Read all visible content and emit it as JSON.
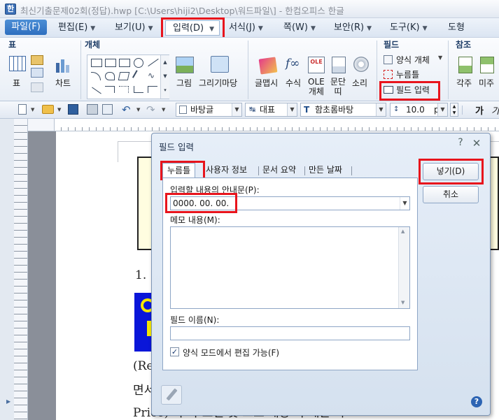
{
  "window": {
    "title": "최신기출문제02회(정답).hwp [C:\\Users\\hiji2\\Desktop\\워드파일\\] - 한컴오피스 한글"
  },
  "menu": {
    "file": "파일(F)",
    "items": [
      "편집(E)",
      "보기(U)",
      "입력(D)",
      "서식(J)",
      "쪽(W)",
      "보안(R)",
      "도구(K)",
      "도형"
    ]
  },
  "ribbon": {
    "groups": {
      "table": "표",
      "object": "개체",
      "field": "필드",
      "ref": "참조"
    },
    "table_label": "표",
    "chart_label": "차트",
    "picture_label": "그림",
    "drawing_label": "그리기마당",
    "textart_label": "글맵시",
    "formula_label": "수식",
    "ole_label": "OLE\n개체",
    "para_label": "문단\n띠",
    "sound_label": "소리",
    "form_object": "양식 개체",
    "click_here": "누름틀",
    "field_input": "필드 입력",
    "footnote_label": "각주",
    "endnote_label": "미주"
  },
  "format_bar": {
    "style": "바탕글",
    "language": "대표",
    "font": "함초롬바탕",
    "size": "10.0",
    "unit": "pt",
    "bold_glyph": "가"
  },
  "document": {
    "number_text": "1.",
    "line1": "(Re",
    "line2": "면서",
    "line3": "Price) 가 가 도일 듯 그도 개당 가 개는 가"
  },
  "dialog": {
    "title": "필드 입력",
    "help_glyph": "?",
    "close_glyph": "✕",
    "tabs": [
      "누름틀",
      "사용자 정보",
      "문서 요약",
      "만든 날짜"
    ],
    "guide_label": "입력할 내용의 안내문(P):",
    "guide_value": "0000. 00. 00.",
    "memo_label": "메모 내용(M):",
    "memo_value": "",
    "name_label": "필드 이름(N):",
    "name_value": "",
    "checkbox_label": "양식 모드에서 편집 가능(F)",
    "checkbox_checked": true,
    "insert_button": "넣기(D)",
    "cancel_button": "취소"
  },
  "colors": {
    "highlight": "#e8141c",
    "accent": "#2e6fbf",
    "doc_yellow_box": "#fffde0",
    "doc_blue_block": "#0a16d9"
  }
}
